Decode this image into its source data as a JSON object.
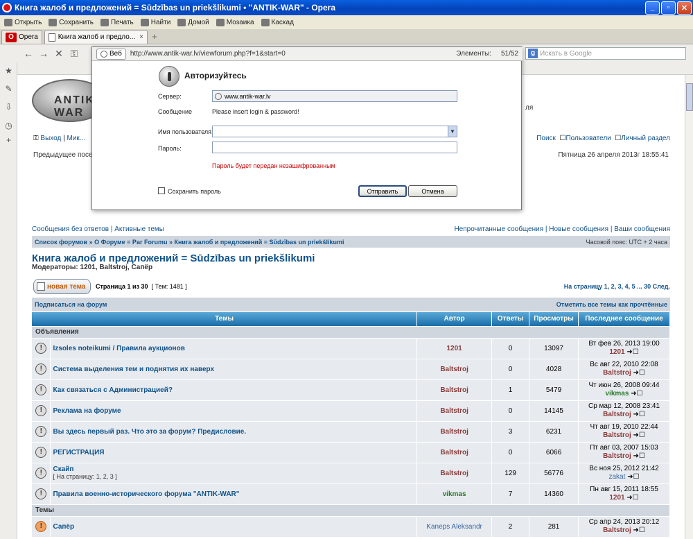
{
  "window": {
    "title": "Книга жалоб и предложений = Sūdzības un priekšlikumi • \"ANTIK-WAR\" - Opera"
  },
  "menu": [
    "Открыть",
    "Сохранить",
    "Печать",
    "Найти",
    "Домой",
    "Мозаика",
    "Каскад"
  ],
  "tabs": {
    "opera": "Opera",
    "active": "Книга жалоб и предло..."
  },
  "search": {
    "placeholder": "Искать в Google"
  },
  "forum": {
    "logo": "ANTIK-WAR",
    "header_fragment": "ля",
    "user_links": [
      "Выход",
      "Мик..."
    ],
    "user_links_right": [
      "Поиск",
      "Пользователи",
      "Личный раздел"
    ],
    "prev_visit": "Предыдущее посе...",
    "date_now": "Пятница 26 апреля 2013г 18:55:41",
    "quick_left": "Сообщения без ответов | Активные темы",
    "quick_right": "Непрочитанные сообщения | Новые сообщения | Ваши сообщения",
    "breadcrumb": "Список форумов » О Форуме = Par Forumu » Книга жалоб и предложений = Sūdzības un priekšlikumi",
    "tz": "Часовой пояс: UTC + 2 часа",
    "title": "Книга жалоб и предложений = Sūdzības un priekšlikumi",
    "moderators": "Модераторы: 1201, Baltstroj, Сапёр",
    "new_topic": "новая тема",
    "page_info": "Страница 1 из 30",
    "topics_count": "[ Тем: 1481 ]",
    "pagination": "На страницу 1, 2, 3, 4, 5 ... 30  След.",
    "subscribe": "Подписаться на форум",
    "mark_read": "Отметить все темы как прочтённые",
    "columns": [
      "Темы",
      "Автор",
      "Ответы",
      "Просмотры",
      "Последнее сообщение"
    ],
    "section_announce": "Объявления",
    "section_topics": "Темы",
    "rows": [
      {
        "title": "Izsoles noteikumi / Правила аукционов",
        "author": "1201",
        "replies": "0",
        "views": "13097",
        "last_date": "Вт фев 26, 2013 19:00",
        "last_user": "1201"
      },
      {
        "title": "Система выделения тем и поднятия их наверх",
        "author": "Baltstroj",
        "replies": "0",
        "views": "4028",
        "last_date": "Вс авг 22, 2010 22:08",
        "last_user": "Baltstroj"
      },
      {
        "title": "Как связаться с Администрацией?",
        "author": "Baltstroj",
        "replies": "1",
        "views": "5479",
        "last_date": "Чт июн 26, 2008 09:44",
        "last_user": "vikmas"
      },
      {
        "title": "Реклама на форуме",
        "author": "Baltstroj",
        "replies": "0",
        "views": "14145",
        "last_date": "Ср мар 12, 2008 23:41",
        "last_user": "Baltstroj"
      },
      {
        "title": "Вы здесь первый раз. Что это за форум? Предисловие.",
        "author": "Baltstroj",
        "replies": "3",
        "views": "6231",
        "last_date": "Чт авг 19, 2010 22:44",
        "last_user": "Baltstroj"
      },
      {
        "title": "РЕГИСТРАЦИЯ",
        "author": "Baltstroj",
        "replies": "0",
        "views": "6066",
        "last_date": "Пт авг 03, 2007 15:03",
        "last_user": "Baltstroj"
      },
      {
        "title": "Скайп",
        "sub": "[ На страницу: 1, 2, 3 ]",
        "author": "Baltstroj",
        "replies": "129",
        "views": "56776",
        "last_date": "Вс ноя 25, 2012 21:42",
        "last_user": "zakat"
      },
      {
        "title": "Правила военно-исторического форума \"ANTIK-WAR\"",
        "author": "vikmas",
        "replies": "7",
        "views": "14360",
        "last_date": "Пн авг 15, 2011 18:55",
        "last_user": "1201"
      }
    ],
    "topic_rows": [
      {
        "title": "Сапёр",
        "author": "Kaneps Aleksandr",
        "replies": "2",
        "views": "281",
        "last_date": "Ср апр 24, 2013 20:12",
        "last_user": "Baltstroj"
      }
    ]
  },
  "dialog": {
    "web_label": "Веб",
    "url": "http://www.antik-war.lv/viewforum.php?f=1&start=0",
    "elements_label": "Элементы:",
    "elements_value": "51/52",
    "title": "Авторизуйтесь",
    "server_label": "Сервер:",
    "server_value": "www.antik-war.lv",
    "message_label": "Сообщение",
    "message_value": "Please insert login & password!",
    "user_label": "Имя пользователя:",
    "user_value": "",
    "pass_label": "Пароль:",
    "pass_value": "",
    "warning": "Пароль будет передан незашифрованным",
    "save_label": "Сохранить пароль",
    "ok": "Отправить",
    "cancel": "Отмена"
  }
}
